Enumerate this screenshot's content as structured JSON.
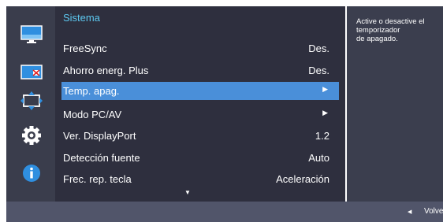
{
  "menu": {
    "title": "Sistema",
    "items": [
      {
        "label": "FreeSync",
        "value": "Des."
      },
      {
        "label": "Ahorro energ. Plus",
        "value": "Des."
      },
      {
        "label": "Temp. apag.",
        "arrow": "▶",
        "selected": true
      },
      {
        "label": "Modo PC/AV",
        "arrow": "▶"
      },
      {
        "label": "Ver. DisplayPort",
        "value": "1.2"
      },
      {
        "label": "Detección fuente",
        "value": "Auto"
      },
      {
        "label": "Frec. rep. tecla",
        "value": "Aceleración"
      }
    ],
    "scroll_indicator": "▼"
  },
  "description": "Active o desactive el\ntemporizador\nde apagado.",
  "sidebar_icons": [
    "picture-icon",
    "color-icon",
    "size-position-icon",
    "gear-icon",
    "info-icon"
  ],
  "bottom_bar": {
    "back_arrow": "◀",
    "back_label": "Volve"
  },
  "colors": {
    "accent": "#4a8fd9",
    "title": "#5cc7ef",
    "panel": "#2e2f3e",
    "sidebar": "#3a3d4c",
    "bottom_bar": "#51556a"
  }
}
